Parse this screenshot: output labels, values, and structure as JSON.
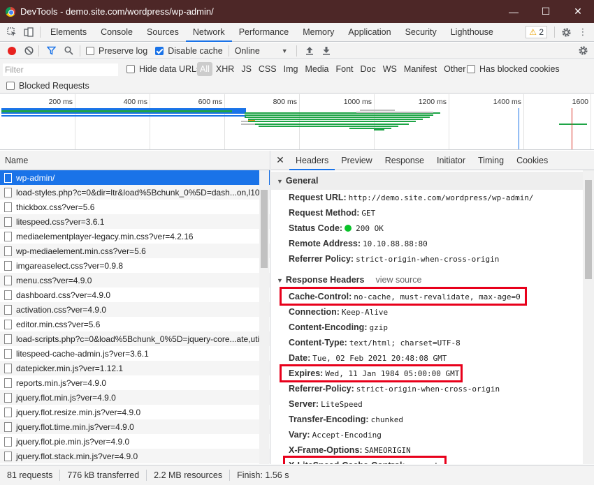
{
  "window": {
    "title": "DevTools - demo.site.com/wordpress/wp-admin/",
    "minimize": "—",
    "maximize": "☐",
    "close": "✕"
  },
  "main_tabs": [
    "Elements",
    "Console",
    "Sources",
    "Network",
    "Performance",
    "Memory",
    "Application",
    "Security",
    "Lighthouse"
  ],
  "active_main_tab": "Network",
  "warnings_badge": "2",
  "toolbar": {
    "preserve_log": "Preserve log",
    "disable_cache": "Disable cache",
    "throttle": "Online"
  },
  "filter": {
    "placeholder": "Filter",
    "hide_data_urls": "Hide data URLs",
    "types": [
      "All",
      "XHR",
      "JS",
      "CSS",
      "Img",
      "Media",
      "Font",
      "Doc",
      "WS",
      "Manifest",
      "Other"
    ],
    "has_blocked_cookies": "Has blocked cookies",
    "blocked_requests": "Blocked Requests"
  },
  "overview": {
    "ticks": [
      "200 ms",
      "400 ms",
      "600 ms",
      "800 ms",
      "1000 ms",
      "1200 ms",
      "1400 ms",
      "1600"
    ],
    "colors": {
      "green": "#1ea446",
      "blue": "#1a73e8",
      "orange": "#f39c12",
      "gray": "#bbbbbb",
      "red": "#d93025"
    }
  },
  "requests": {
    "header": "Name",
    "items": [
      "wp-admin/",
      "load-styles.php?c=0&dir=ltr&load%5Bchunk_0%5D=dash...on,l10",
      "thickbox.css?ver=5.6",
      "litespeed.css?ver=3.6.1",
      "mediaelementplayer-legacy.min.css?ver=4.2.16",
      "wp-mediaelement.min.css?ver=5.6",
      "imgareaselect.css?ver=0.9.8",
      "menu.css?ver=4.9.0",
      "dashboard.css?ver=4.9.0",
      "activation.css?ver=4.9.0",
      "editor.min.css?ver=5.6",
      "load-scripts.php?c=0&load%5Bchunk_0%5D=jquery-core...ate,uti",
      "litespeed-cache-admin.js?ver=3.6.1",
      "datepicker.min.js?ver=1.12.1",
      "reports.min.js?ver=4.9.0",
      "jquery.flot.min.js?ver=4.9.0",
      "jquery.flot.resize.min.js?ver=4.9.0",
      "jquery.flot.time.min.js?ver=4.9.0",
      "jquery.flot.pie.min.js?ver=4.9.0",
      "jquery.flot.stack.min.js?ver=4.9.0"
    ]
  },
  "detail": {
    "tabs": [
      "Headers",
      "Preview",
      "Response",
      "Initiator",
      "Timing",
      "Cookies"
    ],
    "active_tab": "Headers",
    "general_title": "General",
    "general": [
      {
        "k": "Request URL:",
        "v": "http://demo.site.com/wordpress/wp-admin/"
      },
      {
        "k": "Request Method:",
        "v": "GET"
      },
      {
        "k": "Status Code:",
        "v": "200 OK"
      },
      {
        "k": "Remote Address:",
        "v": "10.10.88.88:80"
      },
      {
        "k": "Referrer Policy:",
        "v": "strict-origin-when-cross-origin"
      }
    ],
    "response_title": "Response Headers",
    "view_source": "view source",
    "response": [
      {
        "k": "Cache-Control:",
        "v": "no-cache, must-revalidate, max-age=0"
      },
      {
        "k": "Connection:",
        "v": "Keep-Alive"
      },
      {
        "k": "Content-Encoding:",
        "v": "gzip"
      },
      {
        "k": "Content-Type:",
        "v": "text/html; charset=UTF-8"
      },
      {
        "k": "Date:",
        "v": "Tue, 02 Feb 2021 20:48:08 GMT"
      },
      {
        "k": "Expires:",
        "v": "Wed, 11 Jan 1984 05:00:00 GMT"
      },
      {
        "k": "Referrer-Policy:",
        "v": "strict-origin-when-cross-origin"
      },
      {
        "k": "Server:",
        "v": "LiteSpeed"
      },
      {
        "k": "Transfer-Encoding:",
        "v": "chunked"
      },
      {
        "k": "Vary:",
        "v": "Accept-Encoding"
      },
      {
        "k": "X-Frame-Options:",
        "v": "SAMEORIGIN"
      },
      {
        "k": "X-LiteSpeed-Cache-Control:",
        "v": "no-cache"
      }
    ]
  },
  "status": {
    "requests": "81 requests",
    "transferred": "776 kB transferred",
    "resources": "2.2 MB resources",
    "finish": "Finish: 1.56 s"
  }
}
